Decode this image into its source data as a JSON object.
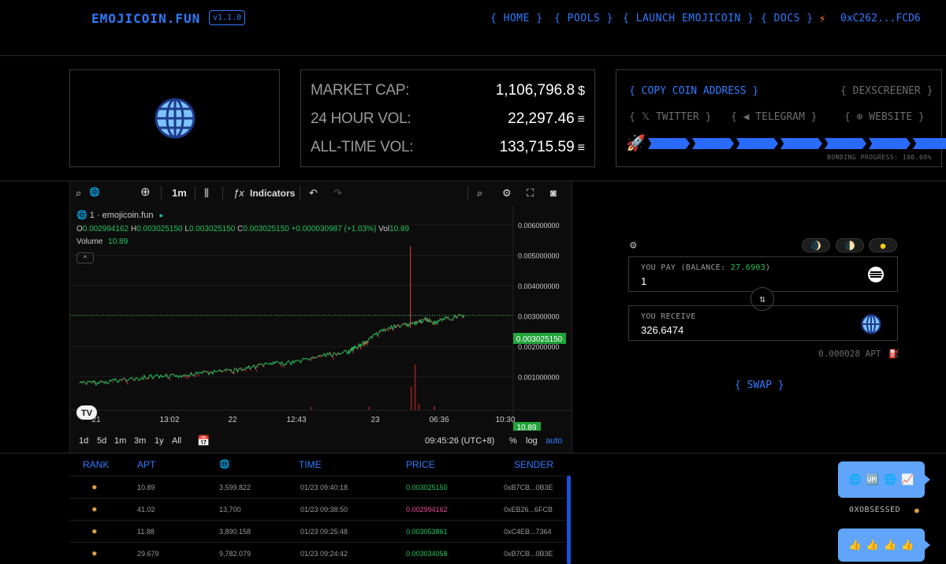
{
  "header": {
    "logo": "EMOJICOIN.FUN",
    "version": "v1.1.0",
    "nav": [
      "{ HOME }",
      "{ POOLS }",
      "{ LAUNCH EMOJICOIN }",
      "{ DOCS }"
    ],
    "wallet": "0xC262...FCD6"
  },
  "coin": {
    "emoji": "🌐"
  },
  "stats": {
    "market_cap_label": "MARKET CAP:",
    "market_cap_value": "1,106,796.8",
    "market_cap_unit": "$",
    "vol24_label": "24 HOUR VOL:",
    "vol24_value": "22,297.46",
    "vol24_unit": "≡",
    "alltime_label": "ALL-TIME VOL:",
    "alltime_value": "133,715.59",
    "alltime_unit": "≡"
  },
  "social": {
    "copy_address": "{  COPY COIN ADDRESS  }",
    "dexscreener": "{  DEXSCREENER  }",
    "twitter": "{  𝕏   TWITTER  }",
    "telegram": "{  ◀   TELEGRAM  }",
    "website": "{  ⊕   WEBSITE  }",
    "bonding_label": "BONDING PROGRESS: 100.00%",
    "bonding_progress": 100
  },
  "chart": {
    "toolbar": {
      "interval": "1m",
      "indicators": "Indicators"
    },
    "symbol": "1 · emojicoin.fun",
    "ohlc_o": "0.002994162",
    "ohlc_h": "0.003025150",
    "ohlc_l": "0.003025150",
    "ohlc_c": "0.003025150",
    "ohlc_change": "+0.000030987 (+1.03%)",
    "ohlc_vol": "10.89",
    "volume_label": "Volume",
    "volume_value": "10.89",
    "price_tag": "0.003025150",
    "volume_tag": "10.89",
    "y_ticks": [
      "0.006000000",
      "0.005000000",
      "0.004000000",
      "0.003000000",
      "0.002000000",
      "0.001000000"
    ],
    "x_ticks": [
      "21",
      "13:02",
      "22",
      "12:43",
      "23",
      "06:36",
      "10:30"
    ],
    "timeframes": [
      "1d",
      "5d",
      "1m",
      "3m",
      "1y",
      "All"
    ],
    "clock": "09:45:26 (UTC+8)",
    "pct": "%",
    "log": "log",
    "auto": "auto"
  },
  "chart_data": {
    "type": "line",
    "title": "",
    "ylabel": "",
    "ylim": [
      0,
      0.0065
    ],
    "x": [
      0,
      0.05,
      0.1,
      0.15,
      0.2,
      0.25,
      0.3,
      0.35,
      0.4,
      0.45,
      0.5,
      0.55,
      0.6,
      0.65,
      0.7,
      0.72,
      0.74,
      0.76,
      0.8,
      0.85,
      0.88,
      0.9,
      0.92,
      0.95,
      1.0
    ],
    "series": [
      {
        "values": [
          0.00078,
          0.0008,
          0.00088,
          0.00095,
          0.001,
          0.00102,
          0.00108,
          0.00115,
          0.0012,
          0.00132,
          0.00142,
          0.00146,
          0.0016,
          0.00172,
          0.00183,
          0.00198,
          0.0021,
          0.0023,
          0.0026,
          0.0027,
          0.0028,
          0.0029,
          0.00278,
          0.0029,
          0.003025
        ]
      }
    ]
  },
  "swap": {
    "pay_label": "YOU PAY (BALANCE: ",
    "pay_balance": "27.6903",
    "pay_close": ")",
    "pay_value": "1",
    "receive_label": "YOU RECEIVE",
    "receive_value": "326.6474",
    "gas": "0.000028 APT",
    "button": "{ SWAP }"
  },
  "trades": {
    "headers": [
      "RANK",
      "APT",
      "🌐",
      "TIME",
      "PRICE",
      "SENDER"
    ],
    "rows": [
      {
        "rank": "✹",
        "apt": "10.89",
        "emoji_amt": "3,599.822",
        "time": "01/23 09:40:18",
        "price": "0.003025150",
        "dir": "up",
        "sender": "0xB7CB...0B3E"
      },
      {
        "rank": "✹",
        "apt": "41.02",
        "emoji_amt": "13,700",
        "time": "01/23 09:38:50",
        "price": "0.002994162",
        "dir": "down",
        "sender": "0xEB26...6FCB"
      },
      {
        "rank": "✹",
        "apt": "11.88",
        "emoji_amt": "3,890.158",
        "time": "01/23 09:25:48",
        "price": "0.003053861",
        "dir": "up",
        "sender": "0xC4EB...7364"
      },
      {
        "rank": "✹",
        "apt": "29.679",
        "emoji_amt": "9,782.079",
        "time": "01/23 09:24:42",
        "price": "0.003034058",
        "dir": "up",
        "sender": "0xB7CB...0B3E"
      }
    ]
  },
  "chat": {
    "bubble1": [
      "🌐",
      "🆙",
      "🌐",
      "📈"
    ],
    "user": "0XOBSESSED",
    "bubble2": [
      "👍",
      "👍",
      "👍",
      "👍"
    ]
  }
}
